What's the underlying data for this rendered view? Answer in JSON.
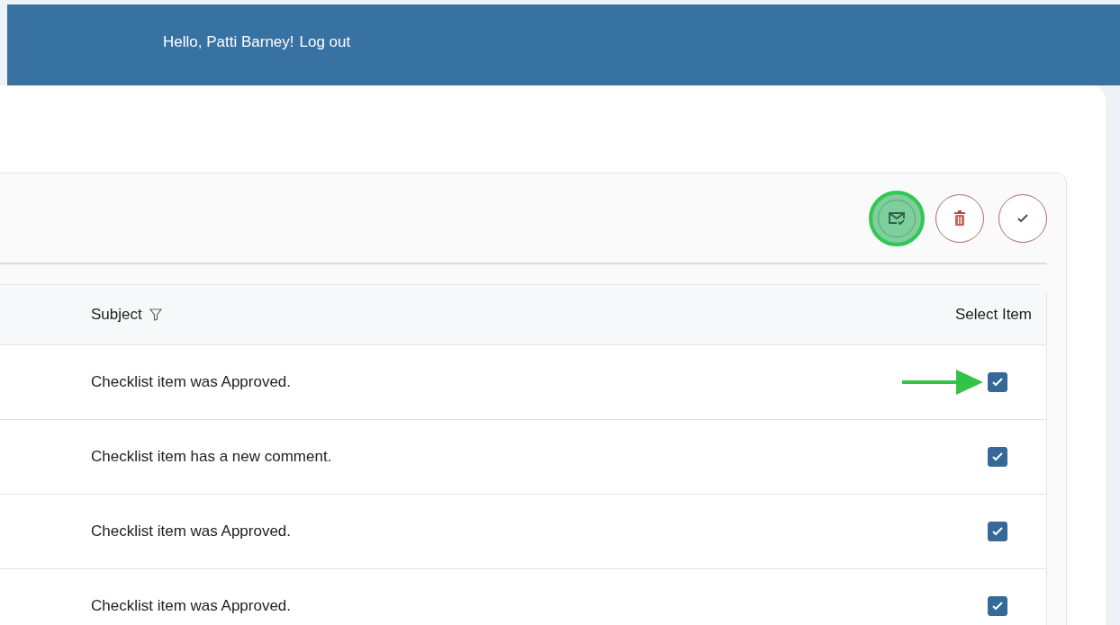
{
  "header": {
    "greeting": "Hello, Patti Barney!",
    "logout": "Log out"
  },
  "toolbar": {
    "buttons": [
      {
        "kind": "mail-check",
        "highlighted": true
      },
      {
        "kind": "delete",
        "highlighted": false
      },
      {
        "kind": "check",
        "highlighted": false
      }
    ]
  },
  "table": {
    "columns": [
      {
        "label": "Subject",
        "filter": true
      },
      {
        "label": "Select Item",
        "filter": false
      }
    ],
    "rows": [
      {
        "subject": "Checklist item was Approved.",
        "checked": true,
        "pointer": true
      },
      {
        "subject": "Checklist item has a new comment.",
        "checked": true,
        "pointer": false
      },
      {
        "subject": "Checklist item was Approved.",
        "checked": true,
        "pointer": false
      },
      {
        "subject": "Checklist item was Approved.",
        "checked": true,
        "pointer": false
      }
    ]
  }
}
